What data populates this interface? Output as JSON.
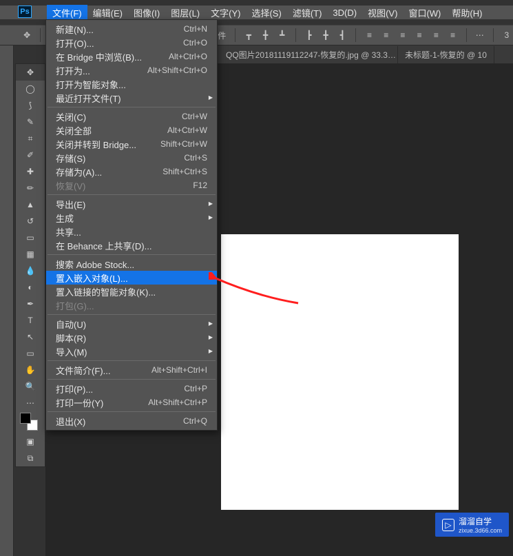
{
  "app": {
    "logo_text": "Ps"
  },
  "menubar": [
    {
      "label": "文件(F)"
    },
    {
      "label": "编辑(E)"
    },
    {
      "label": "图像(I)"
    },
    {
      "label": "图层(L)"
    },
    {
      "label": "文字(Y)"
    },
    {
      "label": "选择(S)"
    },
    {
      "label": "滤镜(T)"
    },
    {
      "label": "3D(D)"
    },
    {
      "label": "视图(V)"
    },
    {
      "label": "窗口(W)"
    },
    {
      "label": "帮助(H)"
    }
  ],
  "options": {
    "trailing": "件"
  },
  "tabs": [
    {
      "label": "QQ图片20181119112247-恢复的.jpg @ 33.3…"
    },
    {
      "label": "未标题-1-恢复的 @ 10"
    }
  ],
  "file_menu": {
    "groups": [
      [
        {
          "label": "新建(N)...",
          "key": "Ctrl+N"
        },
        {
          "label": "打开(O)...",
          "key": "Ctrl+O"
        },
        {
          "label": "在 Bridge 中浏览(B)...",
          "key": "Alt+Ctrl+O"
        },
        {
          "label": "打开为...",
          "key": "Alt+Shift+Ctrl+O"
        },
        {
          "label": "打开为智能对象..."
        },
        {
          "label": "最近打开文件(T)",
          "submenu": true
        }
      ],
      [
        {
          "label": "关闭(C)",
          "key": "Ctrl+W"
        },
        {
          "label": "关闭全部",
          "key": "Alt+Ctrl+W"
        },
        {
          "label": "关闭并转到 Bridge...",
          "key": "Shift+Ctrl+W"
        },
        {
          "label": "存储(S)",
          "key": "Ctrl+S"
        },
        {
          "label": "存储为(A)...",
          "key": "Shift+Ctrl+S"
        },
        {
          "label": "恢复(V)",
          "key": "F12",
          "disabled": true
        }
      ],
      [
        {
          "label": "导出(E)",
          "submenu": true
        },
        {
          "label": "生成",
          "submenu": true
        },
        {
          "label": "共享..."
        },
        {
          "label": "在 Behance 上共享(D)..."
        }
      ],
      [
        {
          "label": "搜索 Adobe Stock..."
        },
        {
          "label": "置入嵌入对象(L)...",
          "hover": true
        },
        {
          "label": "置入链接的智能对象(K)..."
        },
        {
          "label": "打包(G)...",
          "disabled": true
        }
      ],
      [
        {
          "label": "自动(U)",
          "submenu": true
        },
        {
          "label": "脚本(R)",
          "submenu": true
        },
        {
          "label": "导入(M)",
          "submenu": true
        }
      ],
      [
        {
          "label": "文件简介(F)...",
          "key": "Alt+Shift+Ctrl+I"
        }
      ],
      [
        {
          "label": "打印(P)...",
          "key": "Ctrl+P"
        },
        {
          "label": "打印一份(Y)",
          "key": "Alt+Shift+Ctrl+P"
        }
      ],
      [
        {
          "label": "退出(X)",
          "key": "Ctrl+Q"
        }
      ]
    ]
  },
  "tools": [
    "move",
    "marquee-ellipse",
    "lasso",
    "quick-select",
    "crop",
    "eyedropper",
    "spot-heal",
    "brush",
    "clone",
    "history-brush",
    "eraser",
    "gradient",
    "blur",
    "dodge",
    "pen",
    "type",
    "path-select",
    "rectangle",
    "hand",
    "zoom"
  ],
  "watermark": {
    "brand": "溜溜自学",
    "url": "zixue.3d66.com"
  }
}
